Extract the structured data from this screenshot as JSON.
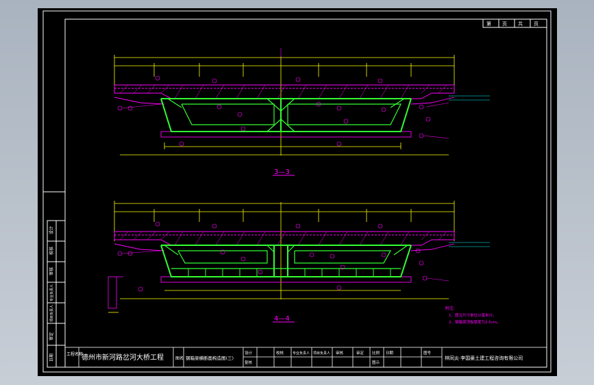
{
  "title_block": {
    "project_label": "工程名称",
    "project_name": "德州市新河路岔河大桥工程",
    "drawing_label": "图名",
    "drawing_name": "钢箱梁横断面构造图(三)",
    "headers": [
      "设计",
      "校核",
      "专业负责人",
      "项目负责人",
      "审核",
      "审定",
      "比例",
      "日期",
      "图号"
    ],
    "row2": [
      "复核",
      "图示"
    ],
    "company": "林同炎·李国豪土建工程咨询有限公司"
  },
  "sheet_tag": [
    "第",
    "页",
    "共",
    "页"
  ],
  "left_column": [
    "设计",
    "校核",
    "审核",
    "专业负责人",
    "项目负责人",
    "审定",
    "日期"
  ],
  "sections": [
    {
      "label": "3—3"
    },
    {
      "label": "4—4"
    }
  ],
  "notes": {
    "heading": "附注:",
    "items": [
      "1、图注尺寸单位以毫米计。",
      "2、钢箱梁顶板厚度为2.5cm。"
    ]
  },
  "colors": {
    "frame": "#ffffff",
    "dimension": "#ffff00",
    "concrete": "#ff00ff",
    "steel": "#33ff33",
    "leader": "#00ffff"
  }
}
